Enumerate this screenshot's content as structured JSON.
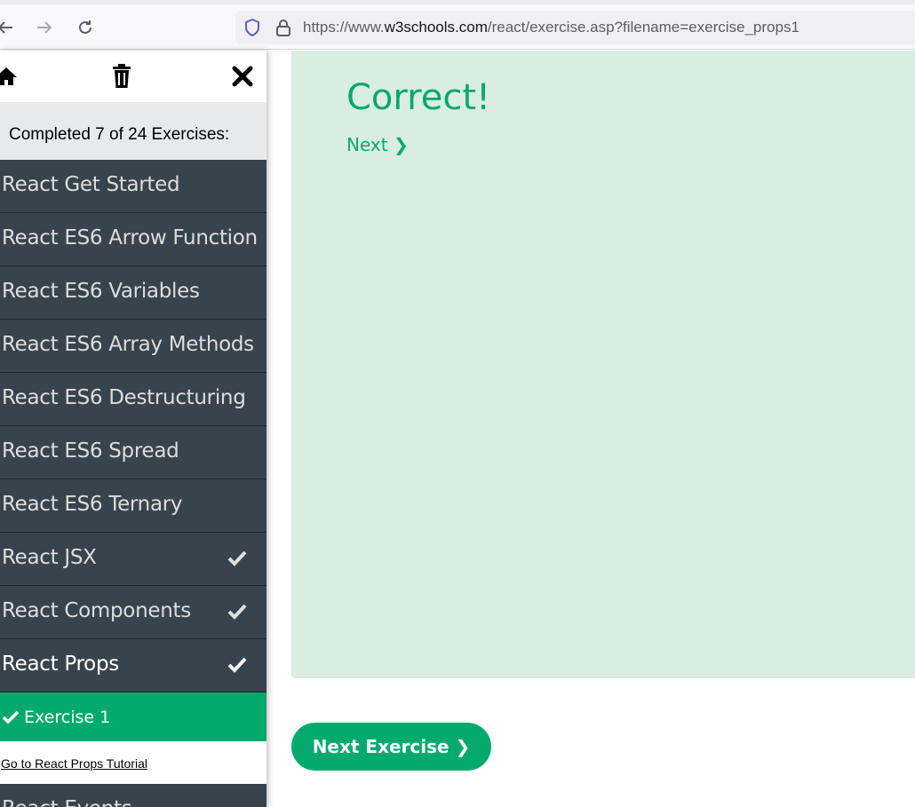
{
  "browser": {
    "url_prefix": "https://www.",
    "url_domain": "w3schools.com",
    "url_path": "/react/exercise.asp?filename=exercise_props1",
    "icons": [
      "back-arrow-icon",
      "forward-arrow-icon",
      "reload-icon",
      "shield-icon",
      "lock-icon"
    ]
  },
  "sidebar": {
    "progress_text": "Completed 7 of 24 Exercises:",
    "items": [
      {
        "label": "React Get Started",
        "completed": false
      },
      {
        "label": "React ES6 Arrow Function",
        "completed": false
      },
      {
        "label": "React ES6 Variables",
        "completed": false
      },
      {
        "label": "React ES6 Array Methods",
        "completed": false
      },
      {
        "label": "React ES6 Destructuring",
        "completed": false
      },
      {
        "label": "React ES6 Spread",
        "completed": false
      },
      {
        "label": "React ES6 Ternary",
        "completed": false
      },
      {
        "label": "React JSX",
        "completed": true
      },
      {
        "label": "React Components",
        "completed": true
      },
      {
        "label": "React Props",
        "completed": true
      }
    ],
    "active_exercise": "Exercise 1",
    "tutorial_link": "Go to React Props Tutorial",
    "next_item_partial": "React Events"
  },
  "main": {
    "result_title": "Correct!",
    "next_link": "Next ❯",
    "next_exercise_button": "Next Exercise ❯"
  },
  "colors": {
    "accent": "#04aa6d",
    "sidebar_bg": "#38444d",
    "panel_bg": "#d9eee1"
  }
}
